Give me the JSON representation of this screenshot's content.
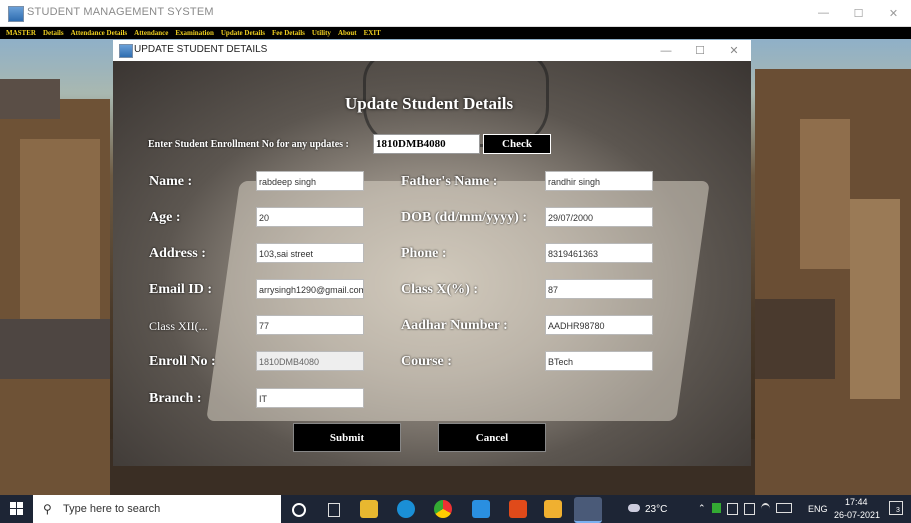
{
  "main_window": {
    "title": "STUDENT MANAGEMENT SYSTEM",
    "controls": {
      "minimize": "—",
      "maximize": "☐",
      "close": "✕"
    },
    "menu": [
      "MASTER",
      "Details",
      "Attendance Details",
      "Attendance",
      "Examination",
      "Update Details",
      "Fee Details",
      "Utility",
      "About",
      "EXIT"
    ]
  },
  "dialog": {
    "title": "UPDATE STUDENT DETAILS",
    "controls": {
      "minimize": "—",
      "maximize": "☐",
      "close": "✕"
    },
    "heading": "Update Student Details",
    "enroll_prompt": "Enter Student Enrollment No for any updates :",
    "enroll_value": "1810DMB4080",
    "check_label": "Check",
    "fields": {
      "name": {
        "label": "Name :",
        "value": "rabdeep singh"
      },
      "father": {
        "label": "Father's Name :",
        "value": "randhir singh"
      },
      "age": {
        "label": "Age :",
        "value": "20"
      },
      "dob": {
        "label": "DOB (dd/mm/yyyy) :",
        "value": "29/07/2000"
      },
      "address": {
        "label": "Address :",
        "value": "103,sai street"
      },
      "phone": {
        "label": "Phone :",
        "value": "8319461363"
      },
      "email": {
        "label": "Email ID :",
        "value": "arrysingh1290@gmail.com"
      },
      "class_x": {
        "label": "Class X(%) :",
        "value": "87"
      },
      "class_xii": {
        "label": "Class XII(...",
        "value": "77"
      },
      "aadhar": {
        "label": "Aadhar Number :",
        "value": "AADHR98780"
      },
      "enroll_no": {
        "label": "Enroll No :",
        "value": "1810DMB4080"
      },
      "course": {
        "label": "Course :",
        "value": "BTech"
      },
      "branch": {
        "label": "Branch :",
        "value": "IT"
      }
    },
    "submit_label": "Submit",
    "cancel_label": "Cancel"
  },
  "taskbar": {
    "search_placeholder": "Type here to search",
    "weather": "23°C",
    "language": "ENG",
    "time": "17:44",
    "date": "26-07-2021",
    "notification_count": "3"
  },
  "colors": {
    "menu_bg": "#000000",
    "menu_text": "#f0d020",
    "taskbar_bg": "#1d2535",
    "button_bg": "#000000"
  }
}
